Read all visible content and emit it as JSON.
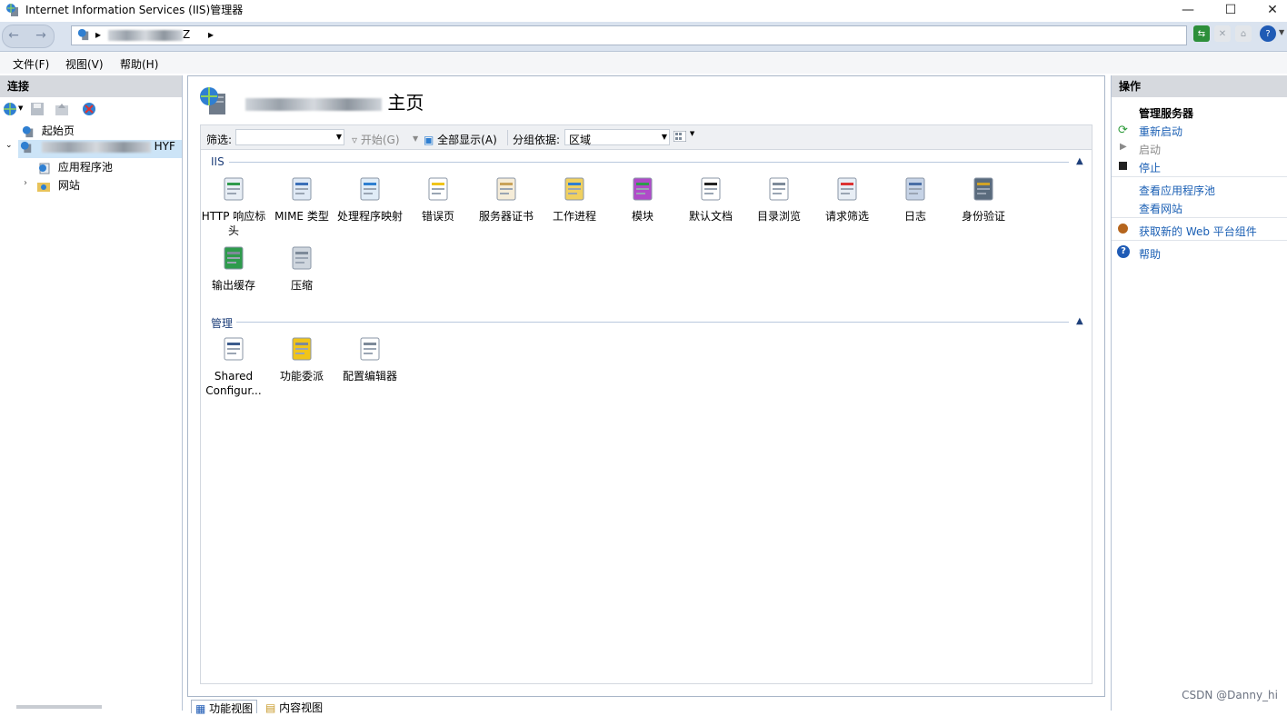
{
  "window": {
    "title": "Internet Information Services (IIS)管理器"
  },
  "address": {
    "segment_suffix": "Z"
  },
  "menu": [
    "文件(F)",
    "视图(V)",
    "帮助(H)"
  ],
  "connections": {
    "header": "连接",
    "tree": {
      "start_page": "起始页",
      "server_suffix": "HYF",
      "app_pools": "应用程序池",
      "sites": "网站"
    }
  },
  "main": {
    "title_suffix": "主页",
    "filter": {
      "label": "筛选:",
      "go_label": "开始(G)",
      "show_all_label": "全部显示(A)",
      "group_label": "分组依据:",
      "group_value": "区域"
    },
    "sections": [
      {
        "name": "IIS",
        "features": [
          {
            "label": "HTTP 响应标头",
            "icon": "http-response-headers-icon"
          },
          {
            "label": "MIME 类型",
            "icon": "mime-types-icon"
          },
          {
            "label": "处理程序映射",
            "icon": "handler-mappings-icon"
          },
          {
            "label": "错误页",
            "icon": "error-pages-icon"
          },
          {
            "label": "服务器证书",
            "icon": "server-certificates-icon"
          },
          {
            "label": "工作进程",
            "icon": "worker-processes-icon"
          },
          {
            "label": "模块",
            "icon": "modules-icon"
          },
          {
            "label": "默认文档",
            "icon": "default-document-icon"
          },
          {
            "label": "目录浏览",
            "icon": "directory-browsing-icon"
          },
          {
            "label": "请求筛选",
            "icon": "request-filtering-icon"
          },
          {
            "label": "日志",
            "icon": "logging-icon"
          },
          {
            "label": "身份验证",
            "icon": "authentication-icon"
          },
          {
            "label": "输出缓存",
            "icon": "output-caching-icon"
          },
          {
            "label": "压缩",
            "icon": "compression-icon"
          }
        ]
      },
      {
        "name": "管理",
        "features": [
          {
            "label": "Shared Configur...",
            "icon": "shared-configuration-icon"
          },
          {
            "label": "功能委派",
            "icon": "feature-delegation-icon"
          },
          {
            "label": "配置编辑器",
            "icon": "configuration-editor-icon"
          }
        ]
      }
    ]
  },
  "actions": {
    "header": "操作",
    "group_title": "管理服务器",
    "restart": "重新启动",
    "start": "启动",
    "stop": "停止",
    "view_app_pools": "查看应用程序池",
    "view_sites": "查看网站",
    "get_new_components": "获取新的 Web 平台组件",
    "help": "帮助"
  },
  "bottom_tabs": {
    "features_view": "功能视图",
    "content_view": "内容视图"
  },
  "watermark": "CSDN @Danny_hi"
}
